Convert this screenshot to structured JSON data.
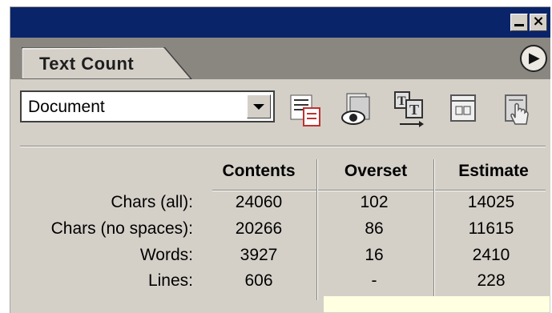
{
  "panel": {
    "tab_label": "Text Count",
    "scope_select": {
      "selected": "Document"
    },
    "toolbar_icons": [
      "text-list-icon",
      "preview-eye-icon",
      "text-flow-icon",
      "page-frame-icon",
      "hand-pointer-icon"
    ],
    "table": {
      "headers": [
        "Contents",
        "Overset",
        "Estimate"
      ],
      "rows": [
        {
          "label": "Chars (all):",
          "contents": "24060",
          "overset": "102",
          "estimate": "14025"
        },
        {
          "label": "Chars (no spaces):",
          "contents": "20266",
          "overset": "86",
          "estimate": "11615"
        },
        {
          "label": "Words:",
          "contents": "3927",
          "overset": "16",
          "estimate": "2410"
        },
        {
          "label": "Lines:",
          "contents": "606",
          "overset": "-",
          "estimate": "228"
        }
      ]
    }
  },
  "colors": {
    "titlebar": "#0a246a",
    "panel_bg": "#d4d0c8",
    "tabstrip": "#8a8780",
    "tooltip_bg": "#ffffe1"
  }
}
